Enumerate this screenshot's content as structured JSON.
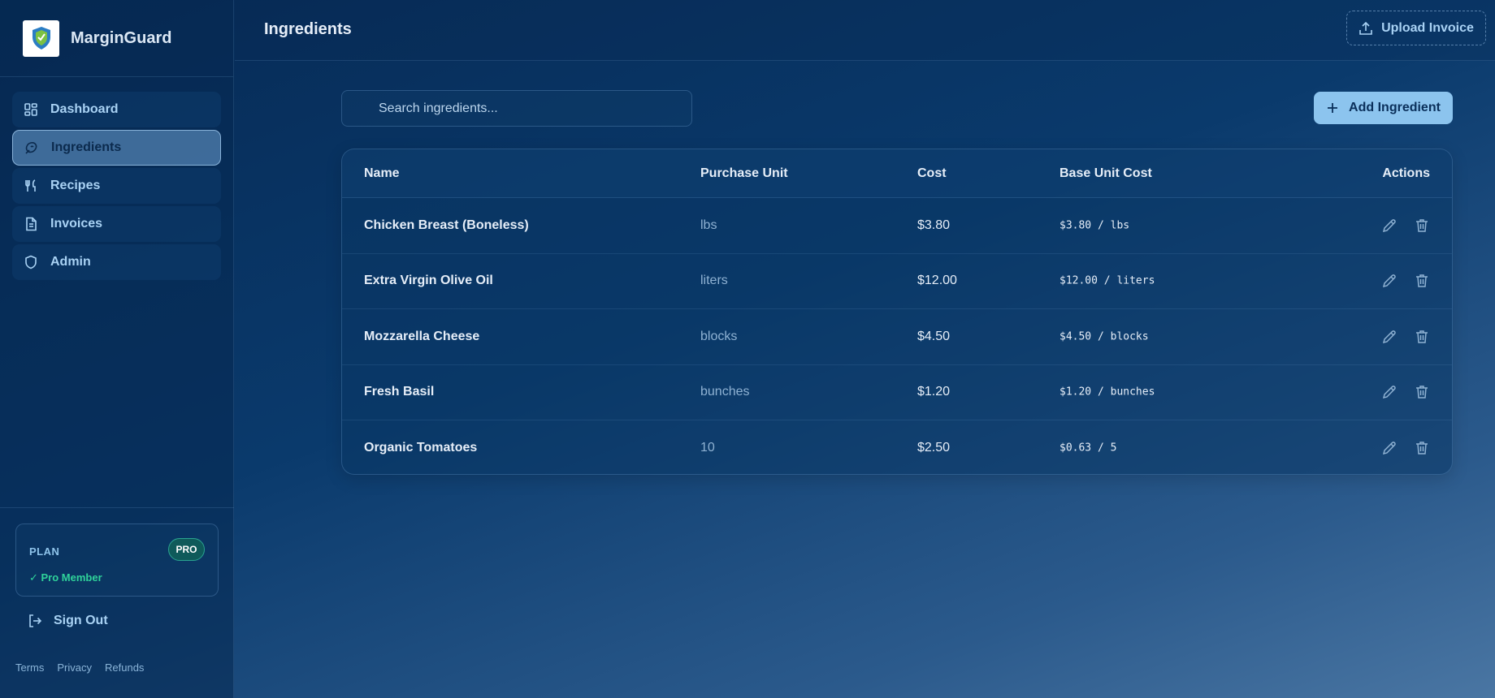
{
  "brand": {
    "name": "MarginGuard"
  },
  "sidebar": {
    "items": [
      {
        "label": "Dashboard",
        "icon": "dashboard-icon",
        "active": false
      },
      {
        "label": "Ingredients",
        "icon": "ingredients-icon",
        "active": true
      },
      {
        "label": "Recipes",
        "icon": "utensils-icon",
        "active": false
      },
      {
        "label": "Invoices",
        "icon": "document-icon",
        "active": false
      },
      {
        "label": "Admin",
        "icon": "shield-icon",
        "active": false
      }
    ],
    "plan": {
      "label": "PLAN",
      "badge": "PRO",
      "status": "✓ Pro Member"
    },
    "signout": "Sign Out",
    "footer": [
      "Terms",
      "Privacy",
      "Refunds"
    ]
  },
  "header": {
    "title": "Ingredients",
    "upload_label": "Upload Invoice"
  },
  "search": {
    "placeholder": "Search ingredients..."
  },
  "add_button": {
    "label": "Add Ingredient"
  },
  "table": {
    "columns": [
      "Name",
      "Purchase Unit",
      "Cost",
      "Base Unit Cost",
      "Actions"
    ],
    "rows": [
      {
        "name": "Chicken Breast (Boneless)",
        "unit": "lbs",
        "cost": "$3.80",
        "base": "$3.80 / lbs"
      },
      {
        "name": "Extra Virgin Olive Oil",
        "unit": "liters",
        "cost": "$12.00",
        "base": "$12.00 / liters"
      },
      {
        "name": "Mozzarella Cheese",
        "unit": "blocks",
        "cost": "$4.50",
        "base": "$4.50 / blocks"
      },
      {
        "name": "Fresh Basil",
        "unit": "bunches",
        "cost": "$1.20",
        "base": "$1.20 / bunches"
      },
      {
        "name": "Organic Tomatoes",
        "unit": "10",
        "cost": "$2.50",
        "base": "$0.63 / 5"
      }
    ]
  },
  "colors": {
    "accent": "#8cc4ee",
    "pro_green": "#2fd39a",
    "background": "#0a3a6c"
  }
}
